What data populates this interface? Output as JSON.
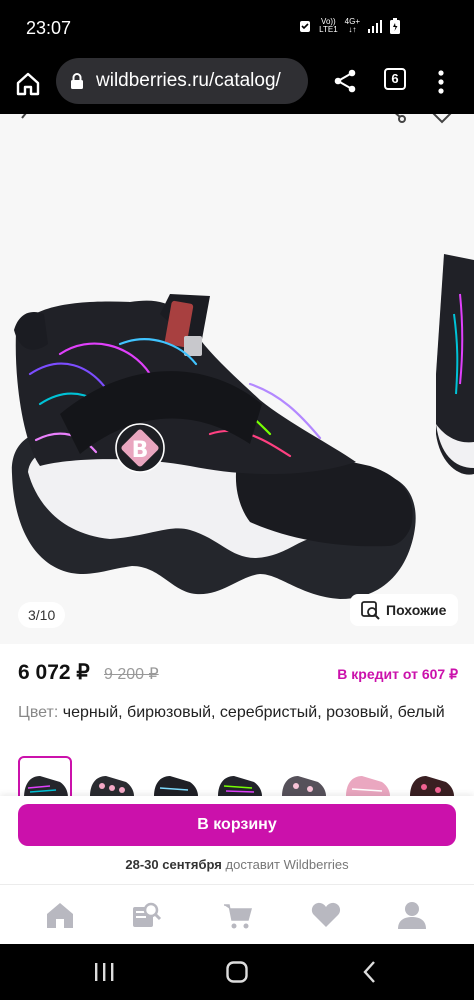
{
  "status_bar": {
    "time": "23:07",
    "net_top": "Vo))",
    "net_bottom": "LTE1",
    "net2_top": "4G+",
    "net2_bottom": "↓↑"
  },
  "browser": {
    "url": "wildberries.ru/catalog/",
    "tab_count": "6"
  },
  "gallery": {
    "counter": "3/10",
    "similar_label": "Похожие"
  },
  "product": {
    "price": "6 072 ₽",
    "old_price": "9 200 ₽",
    "credit": "В кредит от 607 ₽",
    "color_label": "Цвет:",
    "color_value": "черный, бирюзовый, серебристый, розовый, белый"
  },
  "buy": {
    "cart_label": "В корзину",
    "delivery_dates": "28-30 сентября",
    "delivery_text": "доставит Wildberries"
  },
  "colors": {
    "accent": "#cb11ab",
    "nav_icon": "#b8b8c0"
  },
  "icons": {
    "browser": [
      "home-icon",
      "lock-icon",
      "share-icon",
      "tabs-icon",
      "more-vert-icon"
    ],
    "gallery": [
      "back-chevron-icon",
      "share-icon",
      "favorite-outline-icon",
      "similar-search-icon"
    ],
    "bottom_nav": [
      "home-icon",
      "catalog-search-icon",
      "cart-icon",
      "favorites-icon",
      "profile-icon"
    ],
    "system_nav": [
      "recents-icon",
      "home-circle-icon",
      "back-icon"
    ]
  }
}
